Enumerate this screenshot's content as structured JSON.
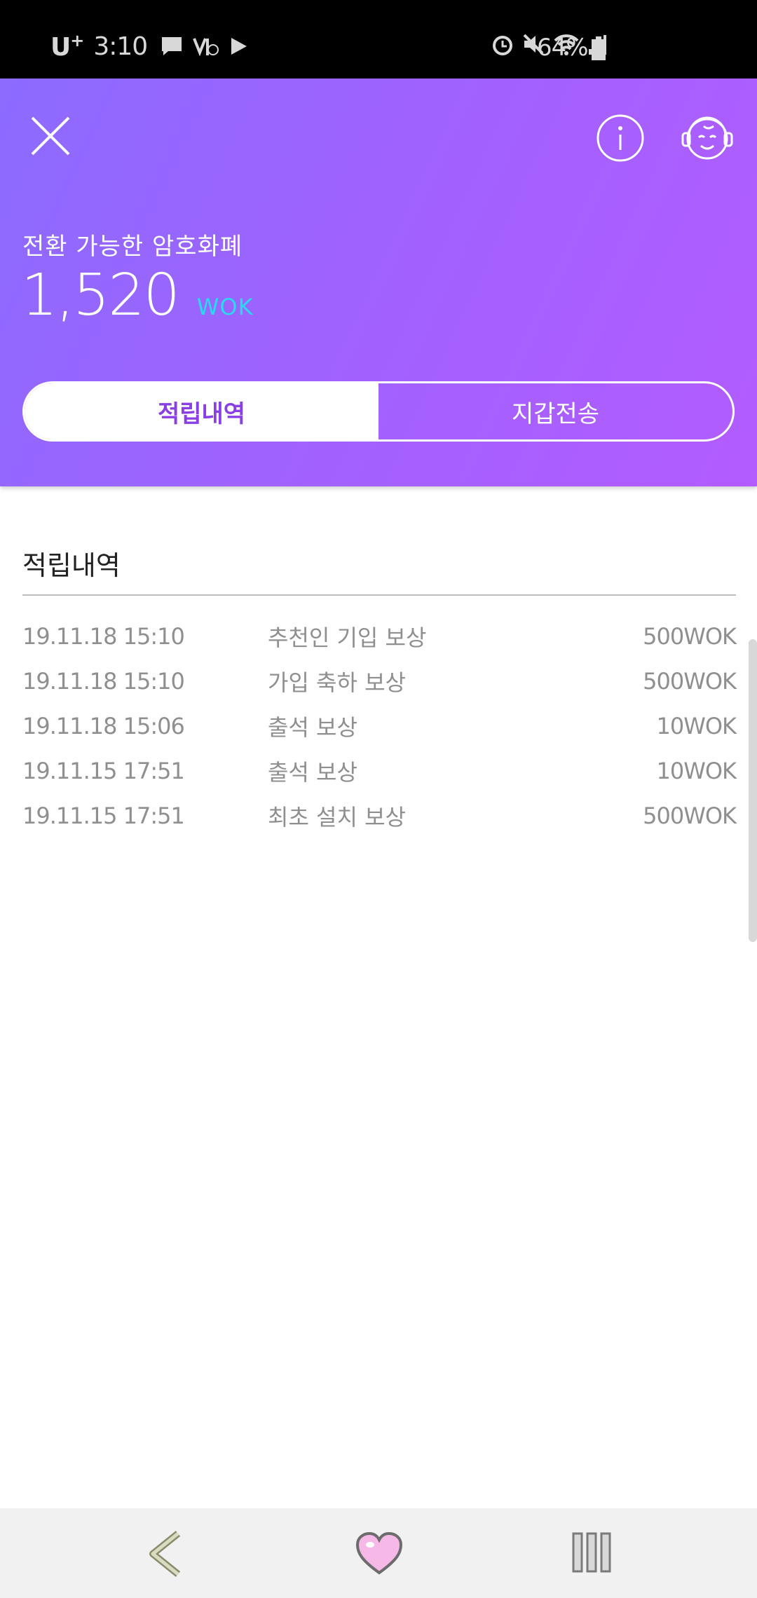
{
  "status_bar": {
    "carrier": "U",
    "carrier_plus": "+",
    "time": "3:10",
    "battery": "64%"
  },
  "header": {
    "balance_label": "전환 가능한 암호화폐",
    "balance_value": "1,520",
    "balance_unit": "WOK",
    "tabs": [
      {
        "label": "적립내역",
        "active": true
      },
      {
        "label": "지갑전송",
        "active": false
      }
    ]
  },
  "history": {
    "title": "적립내역",
    "rows": [
      {
        "date": "19.11.18 15:10",
        "desc": "추천인 기입 보상",
        "amount": "500WOK"
      },
      {
        "date": "19.11.18 15:10",
        "desc": "가입 축하 보상",
        "amount": "500WOK"
      },
      {
        "date": "19.11.18 15:06",
        "desc": "출석 보상",
        "amount": "10WOK"
      },
      {
        "date": "19.11.15 17:51",
        "desc": "출석 보상",
        "amount": "10WOK"
      },
      {
        "date": "19.11.15 17:51",
        "desc": "최초 설치 보상",
        "amount": "500WOK"
      }
    ]
  },
  "colors": {
    "accent": "#8a3fe4",
    "unit": "#28d9f0",
    "header_start": "#8c6bff",
    "header_end": "#b35cff"
  },
  "icons": [
    "close-icon",
    "info-icon",
    "support-icon",
    "back-icon",
    "heart-icon",
    "recent-apps-icon"
  ]
}
